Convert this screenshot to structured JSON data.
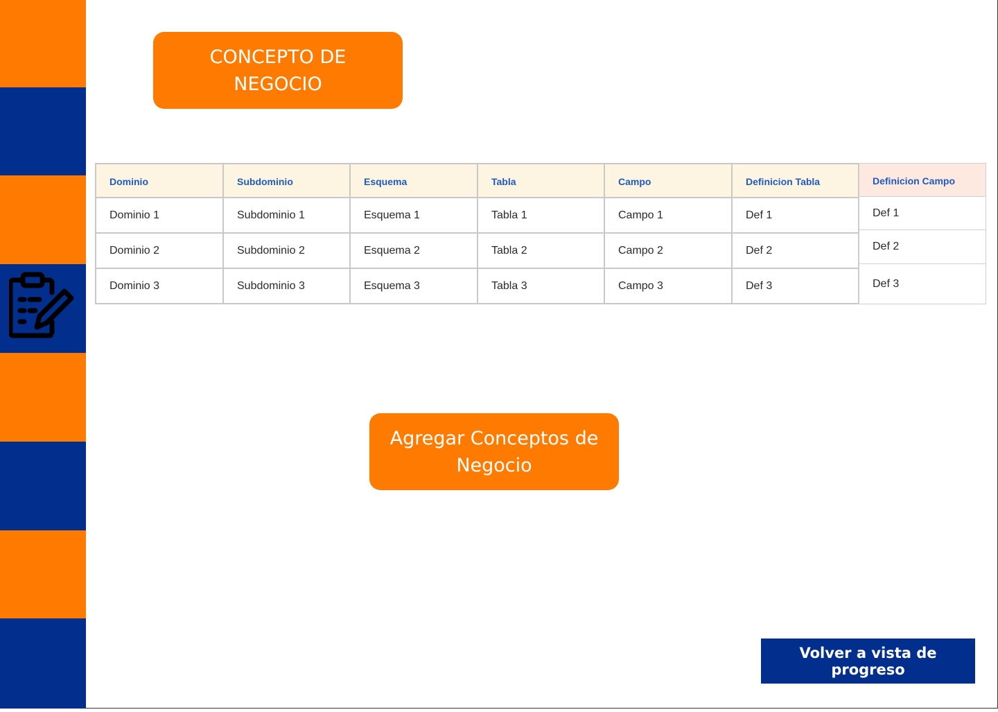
{
  "colors": {
    "orange": "#ff7a00",
    "navy": "#022e8d",
    "header_bg": "#fdf5e2",
    "header_bg_alt": "#fde9df",
    "header_text": "#1f5bbf"
  },
  "sidebar": {
    "stripes": [
      "orange",
      "navy",
      "orange",
      "navy",
      "orange",
      "navy",
      "orange",
      "navy"
    ],
    "icon": "clipboard-edit-icon"
  },
  "page": {
    "title": "CONCEPTO DE NEGOCIO"
  },
  "table": {
    "columns": [
      "Dominio",
      "Subdominio",
      "Esquema",
      "Tabla",
      "Campo",
      "Definicion Tabla",
      "Definicion Campo"
    ],
    "rows": [
      [
        "Dominio 1",
        "Subdominio 1",
        "Esquema 1",
        "Tabla 1",
        "Campo 1",
        "Def 1",
        "Def 1"
      ],
      [
        "Dominio 2",
        "Subdominio 2",
        "Esquema 2",
        "Tabla 2",
        "Campo 2",
        "Def 2",
        "Def 2"
      ],
      [
        "Dominio 3",
        "Subdominio 3",
        "Esquema 3",
        "Tabla 3",
        "Campo 3",
        "Def 3",
        "Def 3"
      ]
    ]
  },
  "actions": {
    "add_label": "Agregar Conceptos de Negocio",
    "back_label": "Volver a vista de progreso"
  }
}
